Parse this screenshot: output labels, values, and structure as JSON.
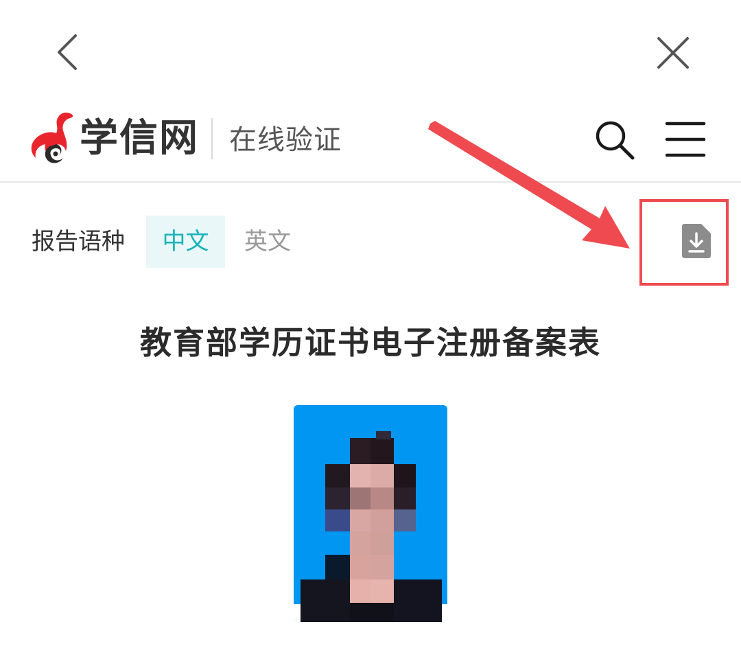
{
  "header": {
    "brand_name": "学信网",
    "brand_sub": "在线验证"
  },
  "report_language": {
    "label": "报告语种",
    "options": [
      {
        "label": "中文",
        "selected": true
      },
      {
        "label": "英文",
        "selected": false
      }
    ]
  },
  "document": {
    "title": "教育部学历证书电子注册备案表"
  },
  "icons": {
    "back": "chevron-left-icon",
    "close": "close-icon",
    "logo": "phoenix-logo",
    "search": "search-icon",
    "menu": "hamburger-menu-icon",
    "download": "file-download-icon"
  },
  "colors": {
    "accent": "#17b3b8",
    "accent_bg": "#eaf7f8",
    "annotation": "#ee4a4f",
    "photo_bg": "#0095f3"
  }
}
